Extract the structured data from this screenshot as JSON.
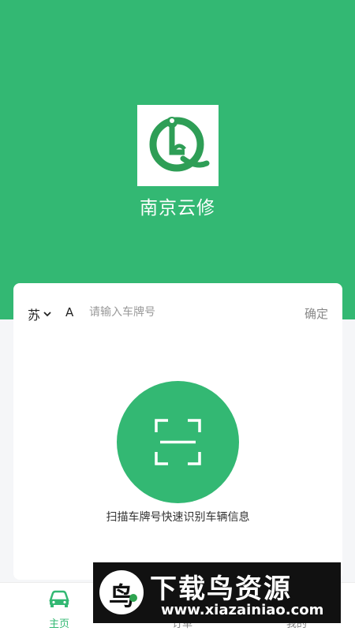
{
  "app": {
    "name": "南京云修"
  },
  "plate": {
    "province": "苏",
    "letter": "A",
    "placeholder": "请输入车牌号",
    "value": "",
    "confirm_label": "确定"
  },
  "scan": {
    "hint": "扫描车牌号快速识别车辆信息"
  },
  "tabs": [
    {
      "label": "主页",
      "icon": "car-icon",
      "active": true
    },
    {
      "label": "订单",
      "icon": "order-icon",
      "active": false
    },
    {
      "label": "",
      "icon": "hidden-tab-icon",
      "active": false
    },
    {
      "label": "我的",
      "icon": "profile-icon",
      "active": false
    }
  ],
  "watermark": {
    "char": "鸟",
    "title": "下载鸟资源",
    "url": "www.xiazainiao.com"
  },
  "colors": {
    "brand": "#33b873",
    "background": "#f5f6f8",
    "card": "#ffffff"
  }
}
